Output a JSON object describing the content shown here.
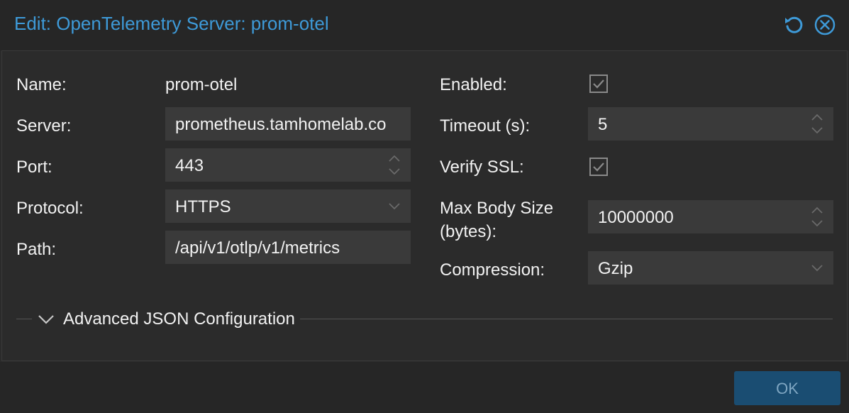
{
  "dialog": {
    "title": "Edit: OpenTelemetry Server: prom-otel",
    "tools": {
      "reset_icon": "reset-icon",
      "close_icon": "close-icon"
    }
  },
  "left": {
    "name": {
      "label": "Name:",
      "value": "prom-otel"
    },
    "server": {
      "label": "Server:",
      "value": "prometheus.tamhomelab.co"
    },
    "port": {
      "label": "Port:",
      "value": "443"
    },
    "protocol": {
      "label": "Protocol:",
      "value": "HTTPS"
    },
    "path": {
      "label": "Path:",
      "value": "/api/v1/otlp/v1/metrics"
    }
  },
  "right": {
    "enabled": {
      "label": "Enabled:",
      "checked": true
    },
    "timeout": {
      "label": "Timeout (s):",
      "value": "5"
    },
    "verify_ssl": {
      "label": "Verify SSL:",
      "checked": true
    },
    "max_body": {
      "label_line1": "Max Body Size",
      "label_line2": "(bytes):",
      "value": "10000000"
    },
    "compression": {
      "label": "Compression:",
      "value": "Gzip"
    }
  },
  "advanced": {
    "title": "Advanced JSON Configuration",
    "collapsed": true
  },
  "footer": {
    "ok_label": "OK"
  },
  "colors": {
    "accent": "#3e9ad8",
    "ok_bg": "#1a4d72",
    "ok_text": "#7fa6c2"
  }
}
